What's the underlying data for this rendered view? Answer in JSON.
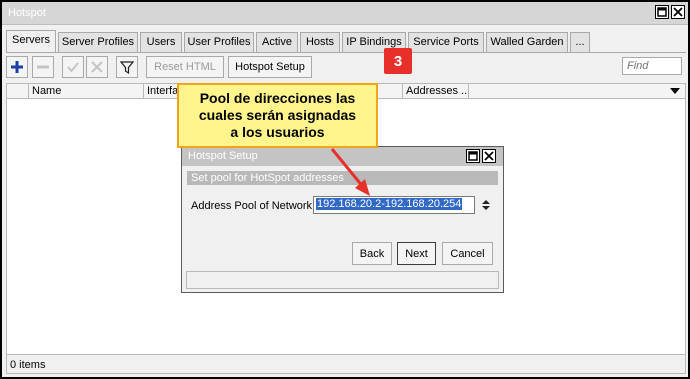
{
  "window": {
    "title": "Hotspot"
  },
  "tabs": [
    {
      "label": "Servers"
    },
    {
      "label": "Server Profiles"
    },
    {
      "label": "Users"
    },
    {
      "label": "User Profiles"
    },
    {
      "label": "Active"
    },
    {
      "label": "Hosts"
    },
    {
      "label": "IP Bindings"
    },
    {
      "label": "Service Ports"
    },
    {
      "label": "Walled Garden"
    },
    {
      "label": "..."
    }
  ],
  "toolbar": {
    "add_icon": "plus-icon",
    "remove_icon": "minus-icon",
    "enable_icon": "check-icon",
    "disable_icon": "x-icon",
    "filter_icon": "funnel-icon",
    "reset_html_label": "Reset HTML",
    "hotspot_setup_label": "Hotspot Setup",
    "find_placeholder": "Find"
  },
  "step_badge": "3",
  "columns": [
    {
      "label": "Name"
    },
    {
      "label": "Interface"
    },
    {
      "label": "Addresses ..."
    }
  ],
  "status_text": "0 items",
  "callout": {
    "line1": "Pool de direcciones las",
    "line2": "cuales serán asignadas",
    "line3": "a los usuarios"
  },
  "dialog": {
    "title": "Hotspot Setup",
    "subtitle": "Set pool for HotSpot addresses",
    "field_label": "Address Pool of Network:",
    "field_value": "192.168.20.2-192.168.20.254",
    "back_label": "Back",
    "next_label": "Next",
    "cancel_label": "Cancel"
  },
  "colors": {
    "badge": "#e8302b",
    "callout_bg": "#fff58c",
    "callout_border": "#f2a51a",
    "arrow": "#e8302b",
    "selection": "#3169c6"
  }
}
